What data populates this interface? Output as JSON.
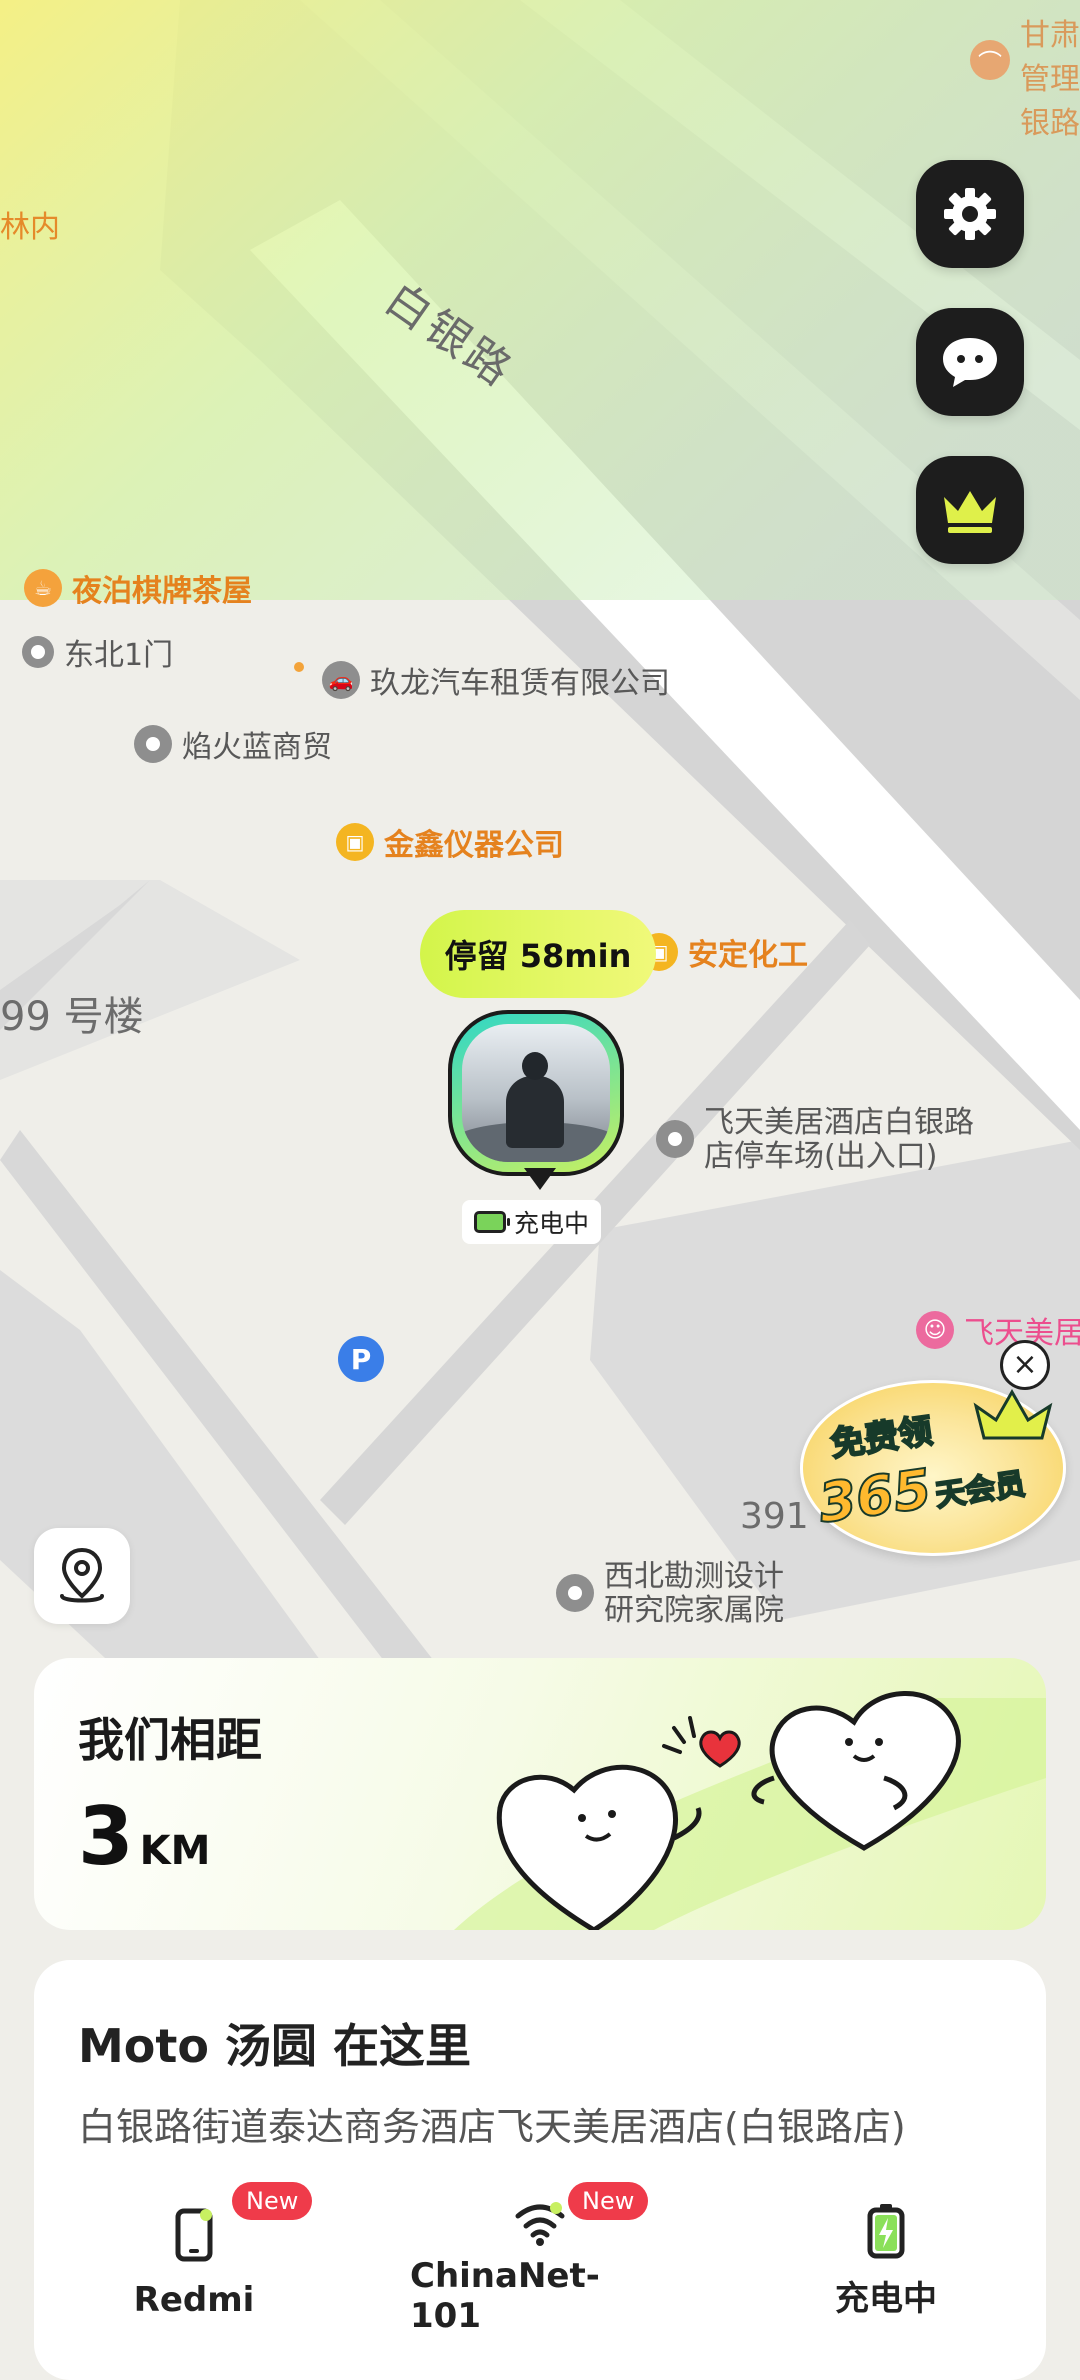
{
  "map": {
    "road_name": "白银路",
    "pois": {
      "top_right_1": "甘肃",
      "top_right_2": "管理",
      "top_right_3": "银路",
      "left_edge": "林内",
      "teahouse": "夜泊棋牌茶屋",
      "northeast_gate": "东北1门",
      "car_rental": "玖龙汽车租赁有限公司",
      "trading": "焰火蓝商贸",
      "instruments": "金鑫仪器公司",
      "chemical": "安定化工",
      "building_399": "99 号楼",
      "parking_line1": "飞天美居酒店白银路",
      "parking_line2": "店停车场(出入口)",
      "hotel_edge": "飞天美居",
      "building_391": "391",
      "residence_line1": "西北勘测设计",
      "residence_line2": "研究院家属院"
    }
  },
  "side_buttons": {
    "settings_icon": "gear-icon",
    "chat_icon": "chat-bubble-icon",
    "vip_icon": "crown-icon"
  },
  "marker": {
    "stay_label": "停留 58min",
    "charging_label": "充电中"
  },
  "promo": {
    "line1": "免费领",
    "number": "365",
    "suffix": "天会员"
  },
  "distance_card": {
    "title": "我们相距",
    "value": "3",
    "unit": "KM"
  },
  "location_card": {
    "title": "Moto 汤圆 在这里",
    "address": "白银路街道泰达商务酒店飞天美居酒店(白银路店)",
    "devices": [
      {
        "label": "Redmi",
        "badge": "New",
        "icon": "phone-icon"
      },
      {
        "label": "ChinaNet-101",
        "badge": "New",
        "icon": "wifi-icon"
      },
      {
        "label": "充电中",
        "badge": "",
        "icon": "battery-charging-icon"
      }
    ]
  },
  "colors": {
    "accent_green": "#d3f54a",
    "badge_red": "#ef3b4a",
    "poi_orange": "#e5821e"
  }
}
